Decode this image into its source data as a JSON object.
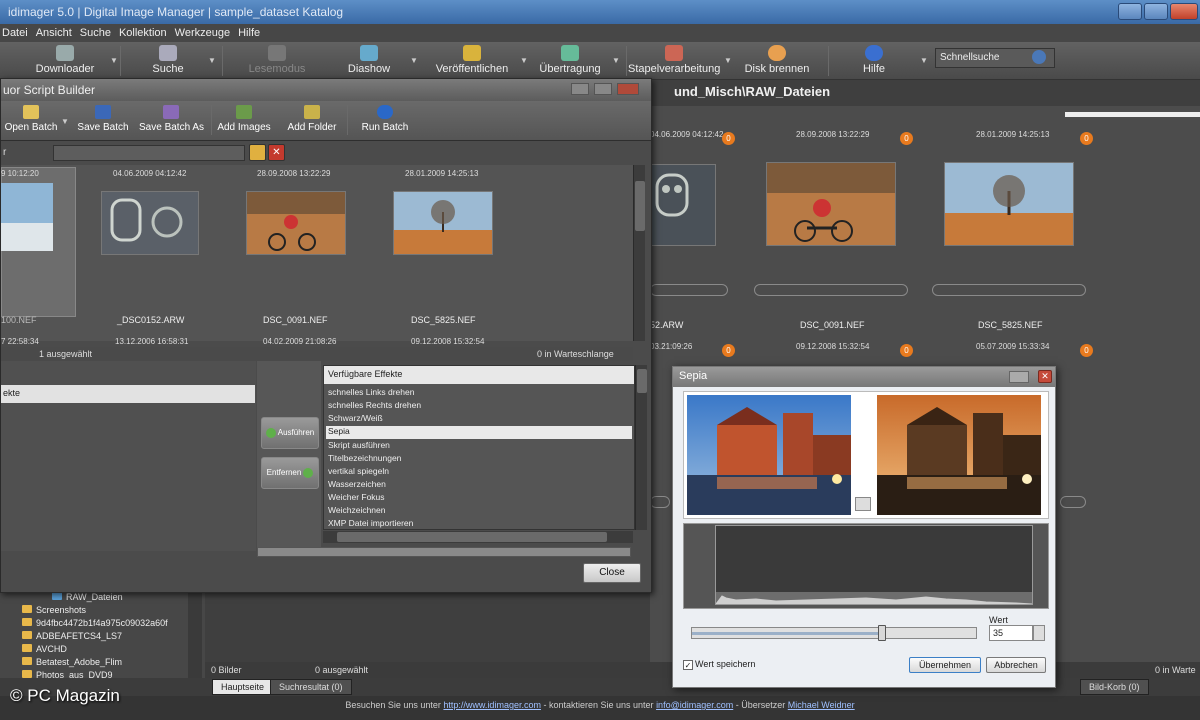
{
  "menu": [
    "Datei",
    "Ansicht",
    "Suche",
    "Kollektion",
    "Werkzeuge",
    "Hilfe"
  ],
  "toolbar": {
    "items": [
      "Downloader",
      "Suche",
      "Lesemodus",
      "Diashow",
      "Veröffentlichen",
      "Übertragung",
      "Stapelverarbeitung",
      "Disk brennen",
      "Hilfe"
    ],
    "quicksearch": "Schnellsuche"
  },
  "path": "und_Misch\\RAW_Dateien",
  "background": {
    "dates_top": [
      "04.06.2009 04:12:42",
      "28.09.2008 13:22:29",
      "28.01.2009 14:25:13"
    ],
    "files": [
      "52.ARW",
      "DSC_0091.NEF",
      "DSC_5825.NEF"
    ],
    "dates_row2": [
      "03.21:09:26",
      "09.12.2008 15:32:54",
      "05.07.2009 15:33:34"
    ],
    "badges": [
      "0",
      "0",
      "0",
      "0",
      "0",
      "0"
    ]
  },
  "builder": {
    "title": "uor Script Builder",
    "toolbar": [
      "Open Batch",
      "Save Batch",
      "Save Batch As",
      "Add Images",
      "Add Folder",
      "Run Batch"
    ],
    "filter_label": "r",
    "thumb_dates": [
      "9 10:12:20",
      "04.06.2009 04:12:42",
      "28.09.2008 13:22:29",
      "28.01.2009 14:25:13"
    ],
    "thumb_files": [
      "100.NEF",
      "_DSC0152.ARW",
      "DSC_0091.NEF",
      "DSC_5825.NEF"
    ],
    "status_dates": [
      "7 22:58:34",
      "13.12.2006 16:58:31",
      "04.02.2009 21:08:26",
      "09.12.2008 15:32:54"
    ],
    "selected": "1 ausgewählt",
    "queue": "0 in Warteschlange",
    "left_item": "ekte",
    "btn_apply": "Ausführen",
    "btn_remove": "Entfernen",
    "effects_header": "Verfügbare Effekte",
    "effects": [
      "schnelles Links drehen",
      "schnelles Rechts drehen",
      "Schwarz/Weiß",
      "Sepia",
      "Skript ausführen",
      "Titelbezeichnungen",
      "vertikal spiegeln",
      "Wasserzeichen",
      "Weicher Fokus",
      "Weichzeichnen",
      "XMP Datei importieren"
    ],
    "selected_effect": "Sepia",
    "close": "Close"
  },
  "sepia": {
    "title": "Sepia",
    "wert_label": "Wert",
    "wert": "35",
    "slider_value": 0.67,
    "save_label": "Wert speichern",
    "ok": "Übernehmen",
    "cancel": "Abbrechen"
  },
  "tree": {
    "root": "RAW_Dateien",
    "items": [
      "Screenshots",
      "9d4fbc4472b1f4a975c09032a60f",
      "ADBEAFETCS4_LS7",
      "AVCHD",
      "Betatest_Adobe_Flim",
      "Photos_aus_DVD9"
    ]
  },
  "status": {
    "left": "0 Bilder",
    "mid": "0 ausgewählt",
    "right": "0 in Warte"
  },
  "tabs": {
    "main": "Hauptseite",
    "search": "Suchresultat (0)",
    "basket": "Bild-Korb (0)"
  },
  "footer": {
    "pre": "Besuchen Sie uns unter",
    "link1": "http://www.idimager.com",
    "mid": "- kontaktieren Sie uns unter",
    "link2": "info@idimager.com",
    "post": "- Übersetzer",
    "link3": "Michael Weidner"
  },
  "window_title": "idimager 5.0 | Digital Image Manager | sample_dataset Katalog",
  "watermark": "© PC Magazin"
}
